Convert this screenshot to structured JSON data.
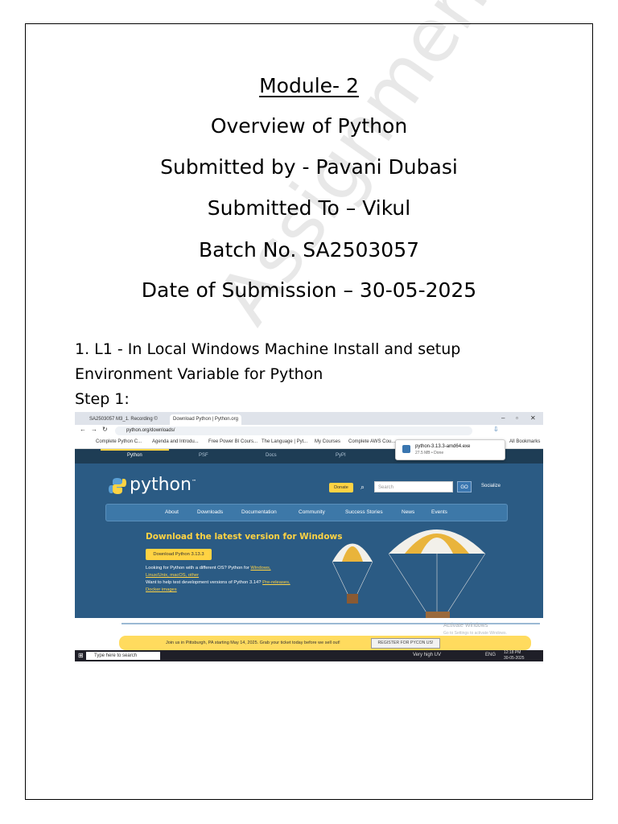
{
  "title": {
    "module": "Module- 2",
    "overview": "Overview of Python",
    "submitted_by": "Submitted by - Pavani Dubasi",
    "submitted_to": "Submitted To – Vikul",
    "batch": "Batch No.  SA2503057",
    "date": "Date of Submission – 30-05-2025"
  },
  "watermark": "Assignment",
  "body": {
    "task_line1": "1. L1 - In Local Windows Machine Install and setup",
    "task_line2": "Environment Variable for Python",
    "step": "Step 1:"
  },
  "screenshot": {
    "tabs": [
      "SA2503057 M3_1. Recording ©",
      "Download Python | Python.org"
    ],
    "url": "python.org/downloads/",
    "bookmarks": [
      "Complete Python C...",
      "Agenda and Introdu...",
      "Free Power BI Cours...",
      "The Language | Pyt...",
      "My Courses",
      "Complete AWS Cou..."
    ],
    "all_bookmarks": "All Bookmarks",
    "download": {
      "file": "python-3.13.3-amd64.exe",
      "status": "27.5 MB • Done"
    },
    "top_nav": [
      "Python",
      "PSF",
      "Docs",
      "PyPI"
    ],
    "logo": "python",
    "logo_tm": "™",
    "donate": "Donate",
    "search_placeholder": "Search",
    "go": "GO",
    "socialize": "Socialize",
    "main_nav": [
      "About",
      "Downloads",
      "Documentation",
      "Community",
      "Success Stories",
      "News",
      "Events"
    ],
    "download_title": "Download the latest version for Windows",
    "download_button": "Download Python 3.13.3",
    "info1_prefix": "Looking for Python with a different OS? Python for ",
    "info1_link": "Windows,",
    "info2_links": "Linux/Unix, macOS, other",
    "info3_prefix": "Want to help test development versions of Python 3.14? ",
    "info3_link": "Pre-releases,",
    "info4_link": "Docker images",
    "activate1": "Activate Windows",
    "activate2": "Go to Settings to activate Windows.",
    "banner_text": "Join us in Pittsburgh, PA starting May 14, 2025. Grab your ticket today before we sell out!",
    "banner_button": "REGISTER FOR PYCON US!",
    "taskbar_search": "Type here to search",
    "weather": "Very high UV",
    "lang": "ENG",
    "time": "12:18 PM",
    "date": "30-05-2025"
  },
  "colors": {
    "python_blue": "#2b5b84",
    "python_yellow": "#ffd343"
  }
}
